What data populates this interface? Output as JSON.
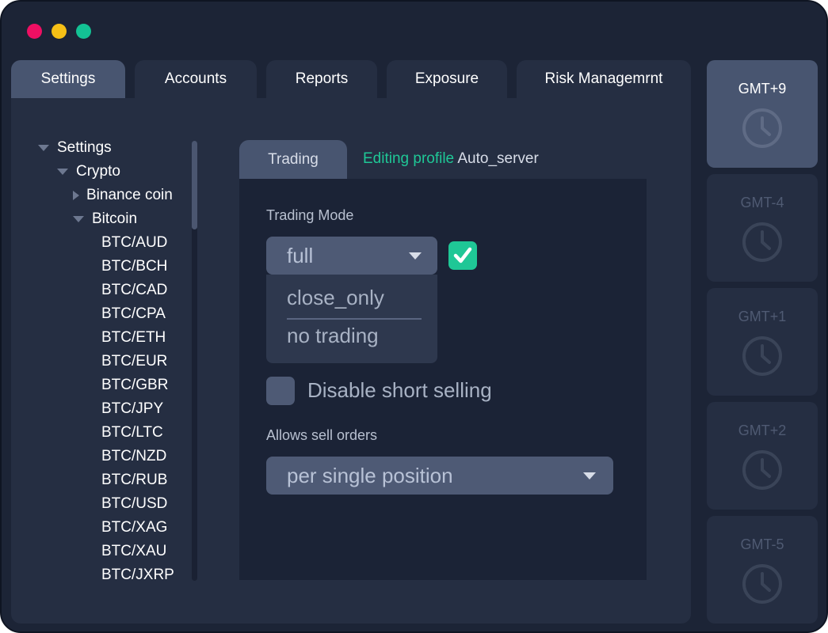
{
  "window": {
    "dots": [
      {
        "name": "close-dot",
        "color": "#ef0f63"
      },
      {
        "name": "minimize-dot",
        "color": "#f6c016"
      },
      {
        "name": "zoom-dot",
        "color": "#13c294"
      }
    ]
  },
  "tabs": [
    {
      "label": "Settings",
      "active": true
    },
    {
      "label": "Accounts",
      "active": false
    },
    {
      "label": "Reports",
      "active": false
    },
    {
      "label": "Exposure",
      "active": false
    },
    {
      "label": "Risk Managemrnt",
      "active": false
    }
  ],
  "tree": {
    "root": "Settings",
    "group": "Crypto",
    "collapsed_item": "Binance coin",
    "expanded_item": "Bitcoin",
    "pairs": [
      "BTC/AUD",
      "BTC/BCH",
      "BTC/CAD",
      "BTC/CPA",
      "BTC/ETH",
      "BTC/EUR",
      "BTC/GBR",
      "BTC/JPY",
      "BTC/LTC",
      "BTC/NZD",
      "BTC/RUB",
      "BTC/USD",
      "BTC/XAG",
      "BTC/XAU",
      "BTC/JXRP"
    ]
  },
  "settings": {
    "tab": "Trading",
    "editing_prefix": "Editing profile",
    "profile_name": "Auto_server",
    "trading_mode_label": "Trading Mode",
    "trading_mode_value": "full",
    "trading_mode_options": [
      "close_only",
      "no trading"
    ],
    "trading_mode_enabled": true,
    "disable_short_selling_label": "Disable short selling",
    "disable_short_selling_checked": false,
    "sell_orders_label": "Allows sell orders",
    "sell_orders_value": "per single position"
  },
  "timezones": [
    {
      "label": "GMT+9",
      "active": true
    },
    {
      "label": "GMT-4",
      "active": false
    },
    {
      "label": "GMT+1",
      "active": false
    },
    {
      "label": "GMT+2",
      "active": false
    },
    {
      "label": "GMT-5",
      "active": false
    }
  ],
  "colors": {
    "accent_green": "#1fc796",
    "window_bg": "#1c2436",
    "panel_bg": "#252e42",
    "active_tab": "#485570"
  }
}
